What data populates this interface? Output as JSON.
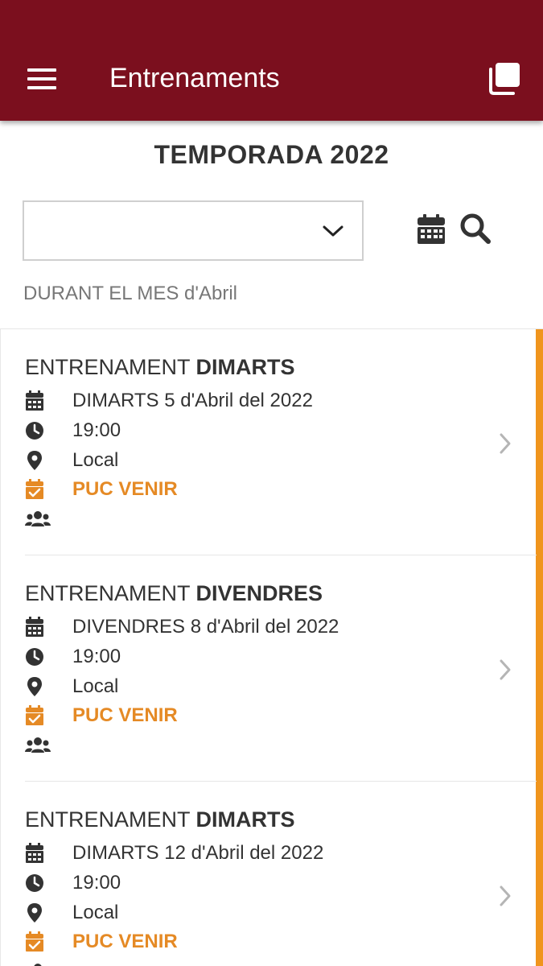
{
  "appbar": {
    "title": "Entrenaments",
    "icons": [
      "menu-icon",
      "copy-icon"
    ],
    "color": "#7b0f1e"
  },
  "season": {
    "title": "TEMPORADA 2022"
  },
  "filter": {
    "selected": "",
    "month_label": "DURANT EL MES d'Abril"
  },
  "colors": {
    "accent": "#f0951d",
    "attend": "#e58a25"
  },
  "trainings": [
    {
      "title_prefix": "ENTRENAMENT ",
      "title_day": "DIMARTS",
      "date": "DIMARTS 5 d'Abril del 2022",
      "time": "19:00",
      "place": "Local",
      "status": "PUC VENIR",
      "attendees": ""
    },
    {
      "title_prefix": "ENTRENAMENT ",
      "title_day": "DIVENDRES",
      "date": "DIVENDRES 8 d'Abril del 2022",
      "time": "19:00",
      "place": "Local",
      "status": "PUC VENIR",
      "attendees": ""
    },
    {
      "title_prefix": "ENTRENAMENT ",
      "title_day": "DIMARTS",
      "date": "DIMARTS 12 d'Abril del 2022",
      "time": "19:00",
      "place": "Local",
      "status": "PUC VENIR",
      "attendees": ""
    }
  ]
}
